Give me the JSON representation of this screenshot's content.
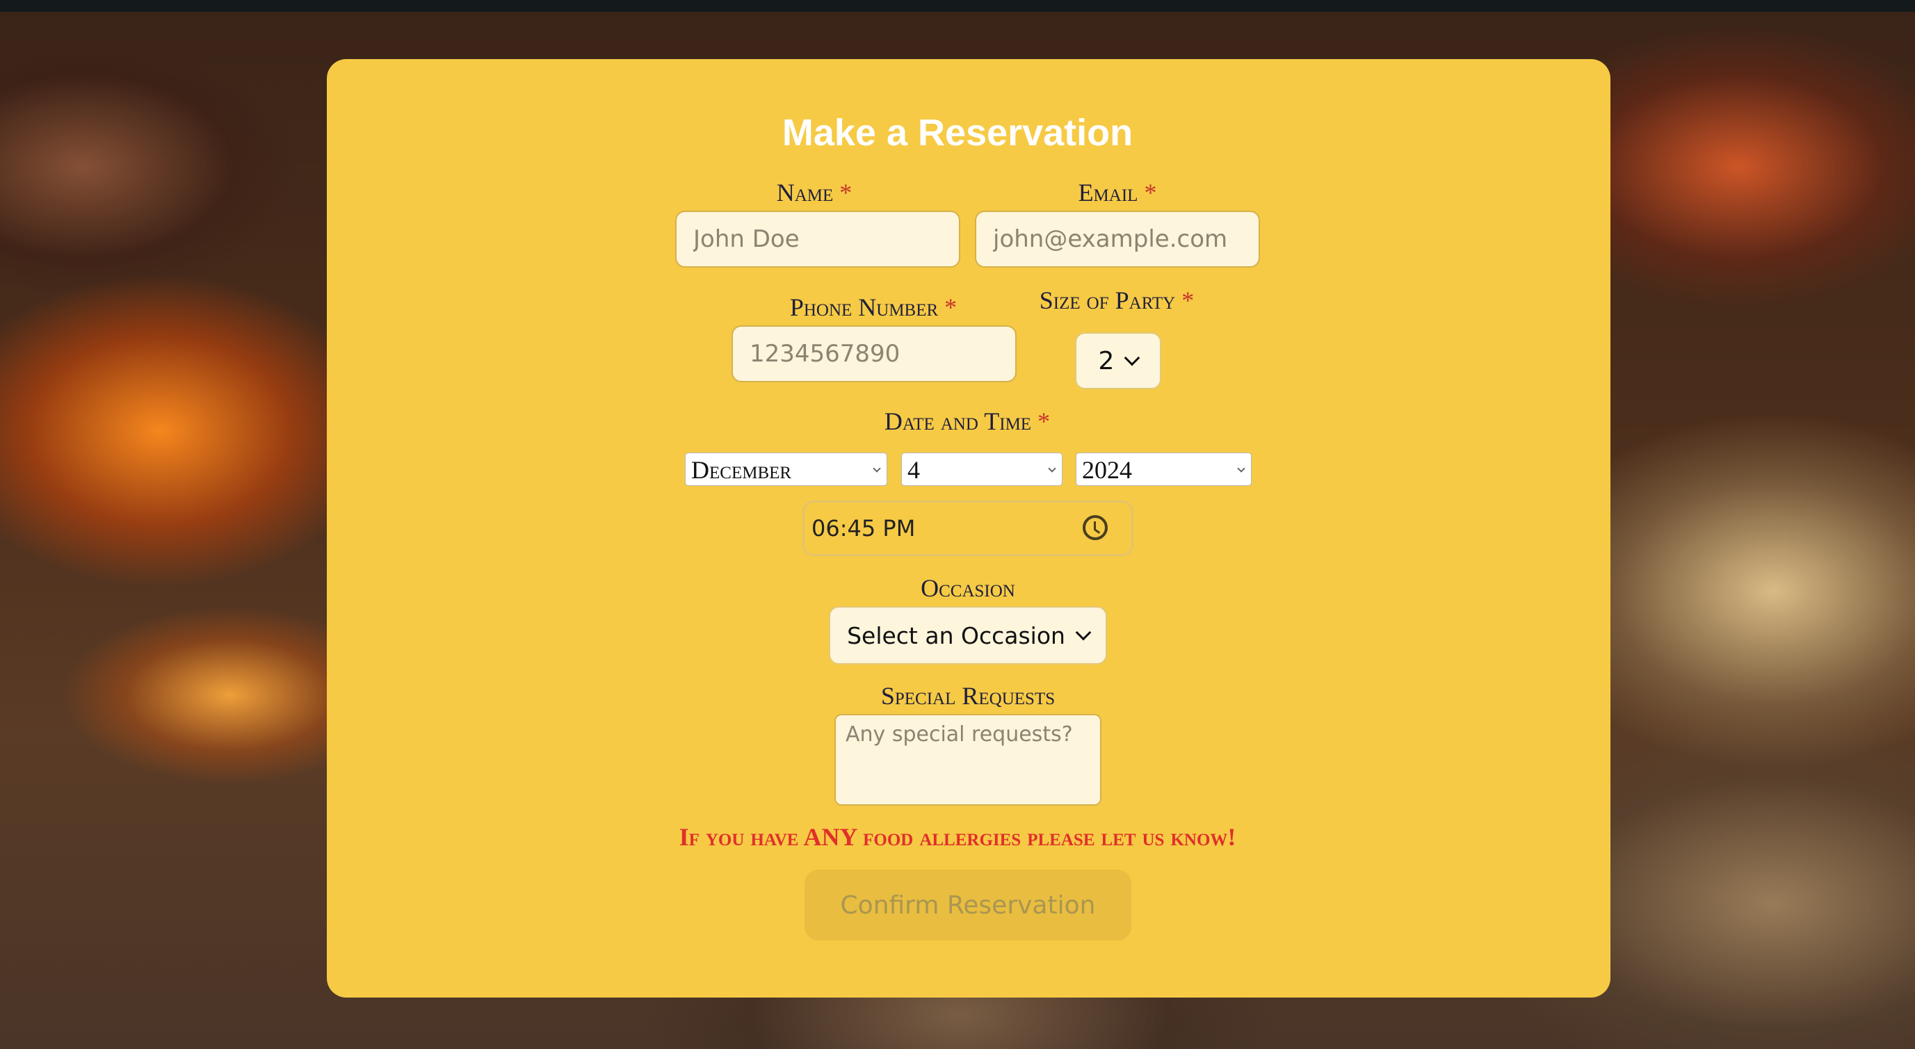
{
  "form": {
    "title": "Make a Reservation",
    "required_marker": "*",
    "name": {
      "label": "Name",
      "placeholder": "John Doe"
    },
    "email": {
      "label": "Email",
      "placeholder": "john@example.com"
    },
    "phone": {
      "label": "Phone Number",
      "placeholder": "1234567890"
    },
    "party_size": {
      "label": "Size of Party",
      "value": "2"
    },
    "date_time": {
      "label": "Date and Time",
      "month": "December",
      "day": "4",
      "year": "2024",
      "time": "06:45 PM"
    },
    "occasion": {
      "label": "Occasion",
      "value": "Select an Occasion"
    },
    "special_requests": {
      "label": "Special Requests",
      "placeholder": "Any special requests?"
    },
    "allergy_note": "If you have ANY food allergies please let us know!",
    "submit_label": "Confirm Reservation"
  },
  "colors": {
    "card_background": "#f6ca45",
    "title": "#ffffff",
    "label_text": "#1f1f3a",
    "required_marker": "#c8362b",
    "allergy_note": "#e0302a",
    "button_background": "#e9bd3f",
    "button_text": "#a99652"
  },
  "icons": {
    "time_picker": "clock-icon",
    "dropdown": "chevron-down-icon"
  }
}
